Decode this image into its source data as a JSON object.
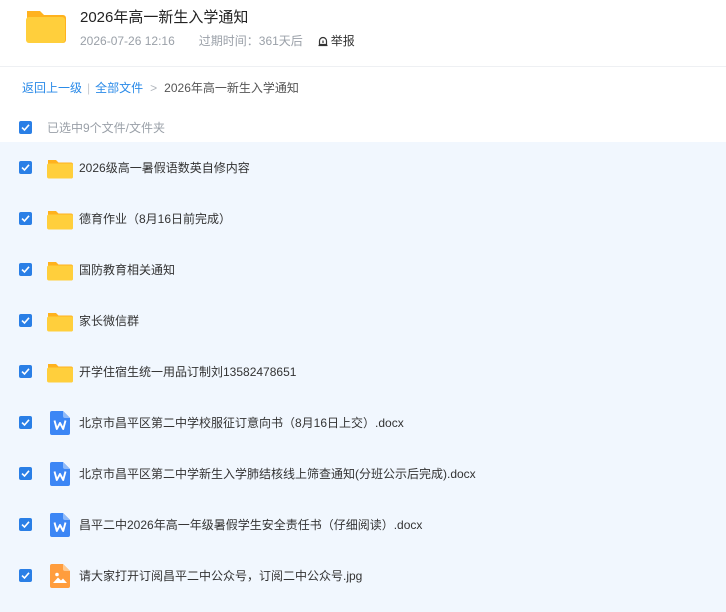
{
  "header": {
    "title": "2026年高一新生入学通知",
    "datetime": "2026-07-26 12:16",
    "expire_label": "过期时间：",
    "expire_value": "361天后",
    "report_label": "举报"
  },
  "breadcrumb": {
    "back": "返回上一级",
    "all_files": "全部文件",
    "current": "2026年高一新生入学通知"
  },
  "selection": {
    "label": "已选中9个文件/文件夹"
  },
  "files": [
    {
      "name": "2026级高一暑假语数英自修内容",
      "type": "folder",
      "checked": true
    },
    {
      "name": "德育作业（8月16日前完成）",
      "type": "folder",
      "checked": true
    },
    {
      "name": "国防教育相关通知",
      "type": "folder",
      "checked": true
    },
    {
      "name": "家长微信群",
      "type": "folder",
      "checked": true
    },
    {
      "name": "开学住宿生统一用品订制刘13582478651",
      "type": "folder",
      "checked": true
    },
    {
      "name": "北京市昌平区第二中学校服征订意向书（8月16日上交）.docx",
      "type": "docx",
      "checked": true
    },
    {
      "name": "北京市昌平区第二中学新生入学肺结核线上筛查通知(分班公示后完成).docx",
      "type": "docx",
      "checked": true
    },
    {
      "name": "昌平二中2026年高一年级暑假学生安全责任书（仔细阅读）.docx",
      "type": "docx",
      "checked": true
    },
    {
      "name": "请大家打开订阅昌平二中公众号，订阅二中公众号.jpg",
      "type": "image",
      "checked": true
    }
  ],
  "colors": {
    "accent": "#2a7fe6",
    "link": "#2a8ae8",
    "folder": "#ffc933",
    "doc": "#3c86f5",
    "image": "#ff9d3d",
    "list_bg": "#f1f7fe"
  }
}
